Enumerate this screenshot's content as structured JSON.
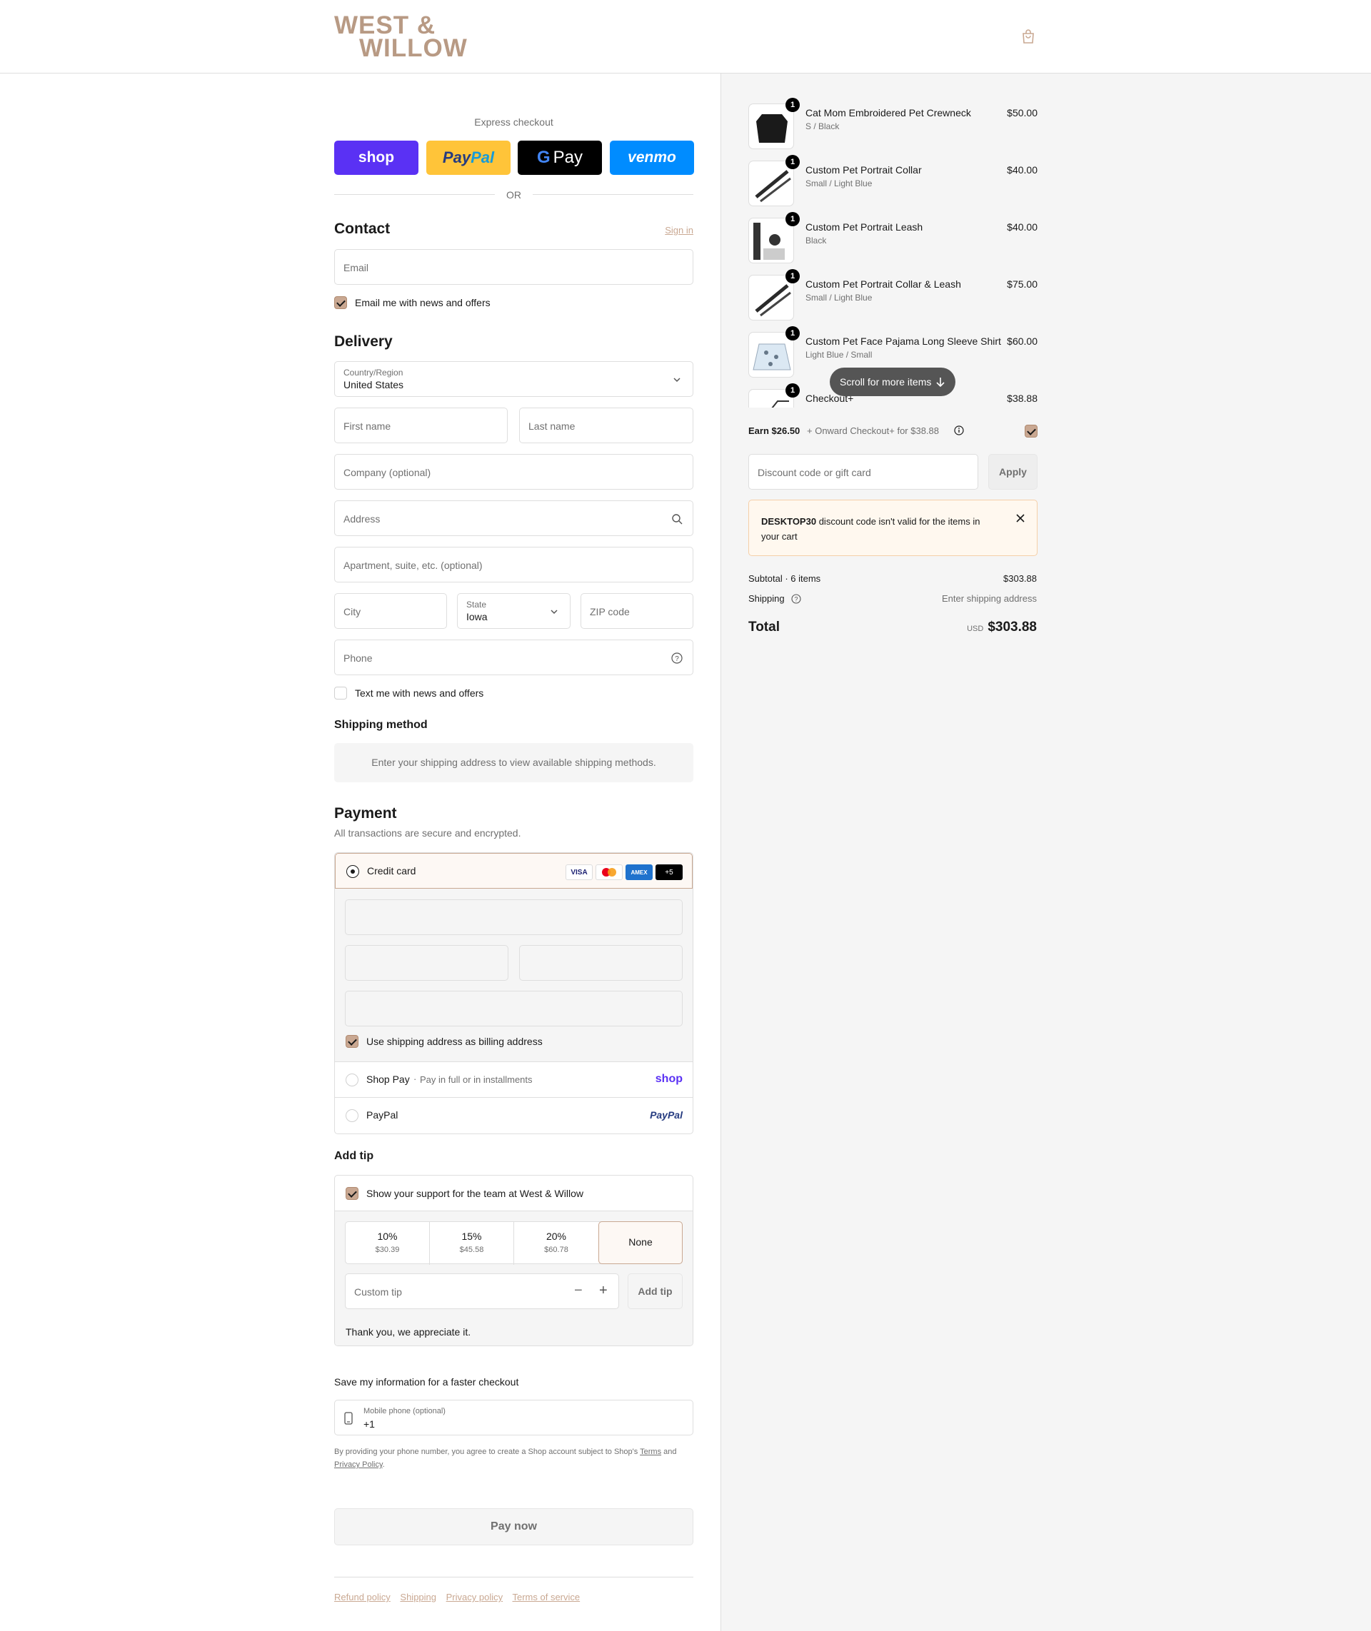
{
  "brand": {
    "line1": "WEST &",
    "line2": "WILLOW"
  },
  "express": {
    "label": "Express checkout",
    "shop": "shop",
    "paypal_a": "Pay",
    "paypal_b": "Pal",
    "gpay": "Pay",
    "venmo": "venmo"
  },
  "or_label": "OR",
  "contact": {
    "title": "Contact",
    "sign_in": "Sign in",
    "email_placeholder": "Email",
    "email_news_label": "Email me with news and offers"
  },
  "delivery": {
    "title": "Delivery",
    "country_label": "Country/Region",
    "country_value": "United States",
    "first_name": "First name",
    "last_name": "Last name",
    "company": "Company (optional)",
    "address": "Address",
    "apartment": "Apartment, suite, etc. (optional)",
    "city": "City",
    "state_label": "State",
    "state_value": "Iowa",
    "zip": "ZIP code",
    "phone": "Phone",
    "text_news_label": "Text me with news and offers"
  },
  "shipping_method": {
    "title": "Shipping method",
    "message": "Enter your shipping address to view available shipping methods."
  },
  "payment": {
    "title": "Payment",
    "subtitle": "All transactions are secure and encrypted.",
    "credit_card": "Credit card",
    "badges": [
      "VISA",
      "",
      "AMEX",
      "+5"
    ],
    "billing_same": "Use shipping address as billing address",
    "shop_pay": "Shop Pay",
    "shop_pay_sub": "Pay in full or in installments",
    "shop_logo": "shop",
    "paypal": "PayPal",
    "paypal_logo": "PayPal"
  },
  "tip": {
    "title": "Add tip",
    "support_label": "Show your support for the team at West & Willow",
    "options": [
      {
        "pct": "10%",
        "amt": "$30.39"
      },
      {
        "pct": "15%",
        "amt": "$45.58"
      },
      {
        "pct": "20%",
        "amt": "$60.78"
      },
      {
        "pct": "None",
        "amt": ""
      }
    ],
    "custom_placeholder": "Custom tip",
    "add_button": "Add tip",
    "thanks": "Thank you, we appreciate it."
  },
  "save_info": {
    "title": "Save my information for a faster checkout",
    "phone_label": "Mobile phone (optional)",
    "phone_value": "+1",
    "disclaimer_a": "By providing your phone number, you agree to create a Shop account subject to Shop's",
    "terms": "Terms",
    "and": "and",
    "privacy": "Privacy Policy"
  },
  "pay_now": "Pay now",
  "footer_links": [
    "Refund policy",
    "Shipping",
    "Privacy policy",
    "Terms of service"
  ],
  "cart": {
    "items": [
      {
        "name": "Cat Mom Embroidered Pet Crewneck",
        "variant": "S / Black",
        "price": "$50.00",
        "qty": "1"
      },
      {
        "name": "Custom Pet Portrait Collar",
        "variant": "Small / Light Blue",
        "price": "$40.00",
        "qty": "1"
      },
      {
        "name": "Custom Pet Portrait Leash",
        "variant": "Black",
        "price": "$40.00",
        "qty": "1"
      },
      {
        "name": "Custom Pet Portrait Collar & Leash",
        "variant": "Small / Light Blue",
        "price": "$75.00",
        "qty": "1"
      },
      {
        "name": "Custom Pet Face Pajama Long Sleeve Shirt",
        "variant": "Light Blue / Small",
        "price": "$60.00",
        "qty": "1"
      },
      {
        "name": "Checkout+",
        "variant": "",
        "price": "$38.88",
        "qty": "1"
      }
    ],
    "scroll_hint": "Scroll for more items",
    "earn_bold": "Earn $26.50",
    "earn_rest": "+ Onward Checkout+ for $38.88",
    "discount_placeholder": "Discount code or gift card",
    "apply": "Apply",
    "error_code": "DESKTOP30",
    "error_rest": "discount code isn't valid for the items in your cart",
    "subtotal_label": "Subtotal · 6 items",
    "subtotal_value": "$303.88",
    "shipping_label": "Shipping",
    "shipping_value": "Enter shipping address",
    "total_label": "Total",
    "currency": "USD",
    "total_value": "$303.88"
  },
  "colors": {
    "accent": "#c9a892",
    "shop_purple": "#5a31f4",
    "paypal_yellow": "#ffc439",
    "venmo_blue": "#008cff"
  }
}
